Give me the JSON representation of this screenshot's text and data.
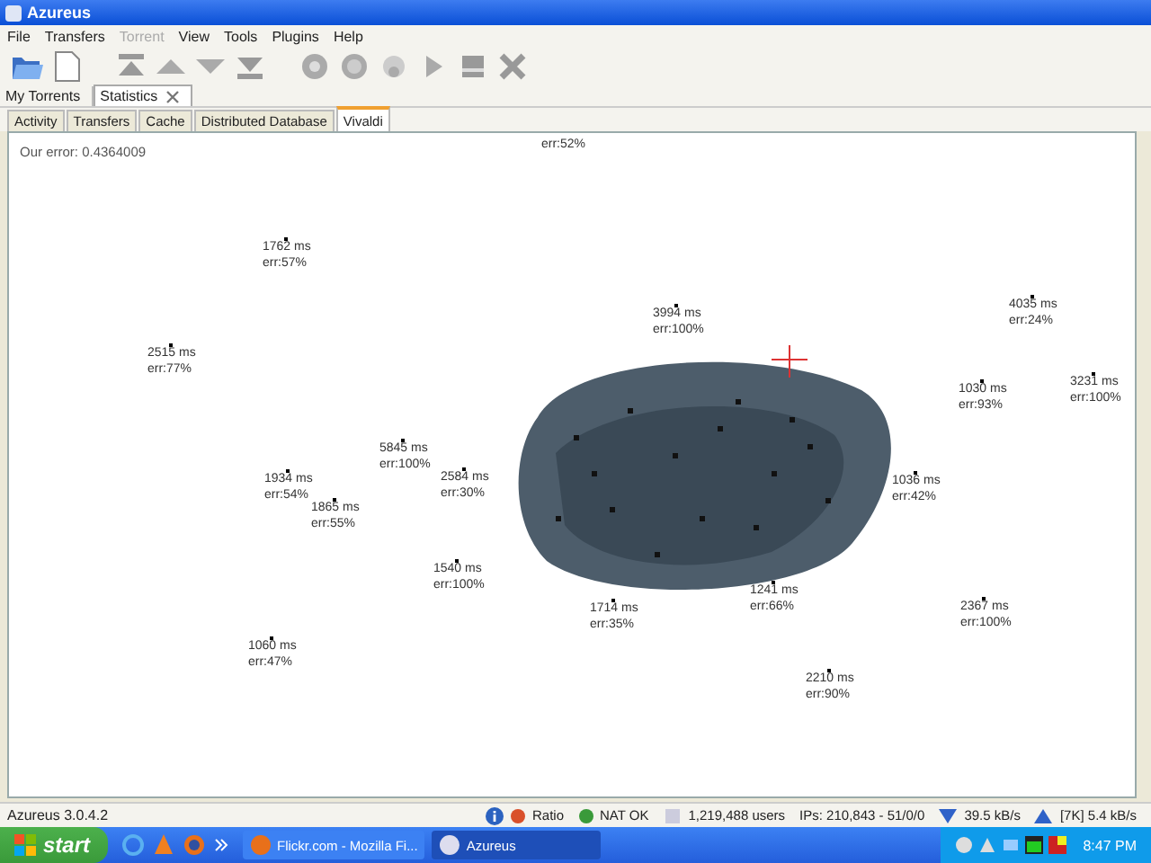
{
  "window": {
    "title": "Azureus"
  },
  "menu": [
    {
      "label": "File",
      "disabled": false
    },
    {
      "label": "Transfers",
      "disabled": false
    },
    {
      "label": "Torrent",
      "disabled": true
    },
    {
      "label": "View",
      "disabled": false
    },
    {
      "label": "Tools",
      "disabled": false
    },
    {
      "label": "Plugins",
      "disabled": false
    },
    {
      "label": "Help",
      "disabled": false
    }
  ],
  "view_tabs": [
    {
      "label": "My Torrents",
      "selected": false,
      "closable": false
    },
    {
      "label": "Statistics",
      "selected": true,
      "closable": true
    }
  ],
  "sub_tabs": [
    {
      "label": "Activity",
      "selected": false
    },
    {
      "label": "Transfers",
      "selected": false
    },
    {
      "label": "Cache",
      "selected": false
    },
    {
      "label": "Distributed Database",
      "selected": false
    },
    {
      "label": "Vivaldi",
      "selected": true
    }
  ],
  "vivaldi": {
    "error_label": "Our error: 0.4364009",
    "nodes": [
      {
        "error": "err:52%"
      },
      {
        "latency": "1762 ms",
        "error": "err:57%"
      },
      {
        "latency": "2515 ms",
        "error": "err:77%"
      },
      {
        "latency": "1934 ms",
        "error": "err:54%"
      },
      {
        "latency": "1865 ms",
        "error": "err:55%"
      },
      {
        "latency": "5845 ms",
        "error": "err:100%"
      },
      {
        "latency": "2584 ms",
        "error": "err:30%"
      },
      {
        "latency": "3994 ms",
        "error": "err:100%"
      },
      {
        "latency": "4035 ms",
        "error": "err:24%"
      },
      {
        "latency": "1030 ms",
        "error": "err:93%"
      },
      {
        "latency": "3231 ms",
        "error": "err:100%"
      },
      {
        "latency": "1036 ms",
        "error": "err:42%"
      },
      {
        "latency": "1540 ms",
        "error": "err:100%"
      },
      {
        "latency": "1714 ms",
        "error": "err:35%"
      },
      {
        "latency": "1241 ms",
        "error": "err:66%"
      },
      {
        "latency": "2367 ms",
        "error": "err:100%"
      },
      {
        "latency": "1060 ms",
        "error": "err:47%"
      },
      {
        "latency": "2210 ms",
        "error": "err:90%"
      }
    ]
  },
  "status_bar": {
    "version": "Azureus 3.0.4.2",
    "indicators": [
      {
        "label": "Ratio",
        "color": "#d9502b"
      },
      {
        "label": "NAT OK",
        "color": "#3a9a3a"
      }
    ],
    "users": "1,219,488 users",
    "ips": "IPs: 210,843 - 51/0/0",
    "download": "39.5 kB/s",
    "upload": "[7K] 5.4 kB/s"
  },
  "taskbar": {
    "start": "start",
    "windows": [
      {
        "label": "Flickr.com - Mozilla Fi...",
        "selected": false
      },
      {
        "label": "Azureus",
        "selected": true
      }
    ],
    "clock": "8:47 PM"
  }
}
